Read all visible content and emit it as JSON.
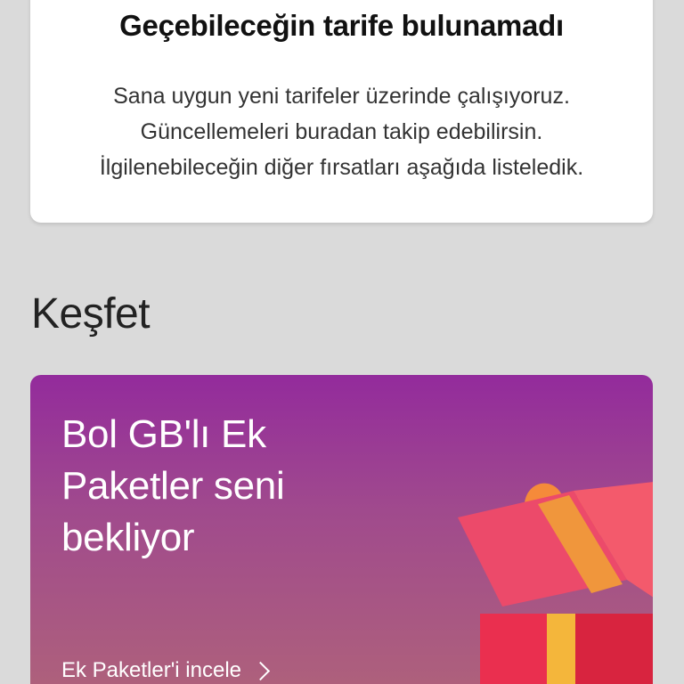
{
  "info_card": {
    "title": "Geçebileceğin tarife bulunamadı",
    "body_lines": [
      "Sana uygun yeni tarifeler üzerinde çalışıyoruz.",
      "Güncellemeleri buradan takip edebilirsin.",
      "İlgilenebileceğin diğer fırsatları aşağıda listeledik."
    ]
  },
  "section": {
    "title": "Keşfet"
  },
  "promo": {
    "headline_lines": [
      "Bol GB'lı Ek",
      "Paketler seni",
      "bekliyor"
    ],
    "link_label": "Ek Paketler'i incele",
    "icon": "gift-icon",
    "colors": {
      "gradient_top": "#932b9c",
      "gradient_bottom": "#b06479"
    }
  }
}
